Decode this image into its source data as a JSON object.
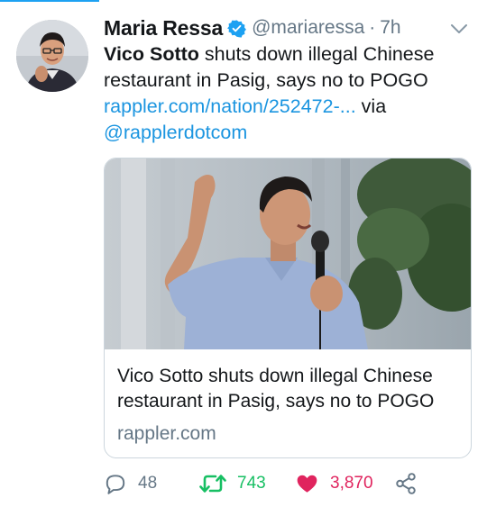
{
  "tweet": {
    "author_name": "Maria Ressa",
    "handle": "@mariaressa",
    "separator": "·",
    "time": "7h",
    "text_bold": "Vico Sotto",
    "text_rest": " shuts down illegal Chinese restaurant in Pasig, says no to POGO ",
    "link": "rappler.com/nation/252472-...",
    "via": " via ",
    "mention": "@rapplerdotcom"
  },
  "card": {
    "title": "Vico Sotto shuts down illegal Chinese restaurant in Pasig, says no to POGO",
    "domain": "rappler.com"
  },
  "actions": {
    "replies": "48",
    "retweets": "743",
    "likes": "3,870"
  },
  "icons": {
    "verified": "verified-badge-icon",
    "more": "chevron-down-icon",
    "reply": "reply-icon",
    "retweet": "retweet-icon",
    "like": "heart-icon",
    "share": "share-icon"
  },
  "colors": {
    "link": "#1b95e0",
    "retweet": "#17bf63",
    "like": "#e0245e",
    "muted": "#657786"
  }
}
